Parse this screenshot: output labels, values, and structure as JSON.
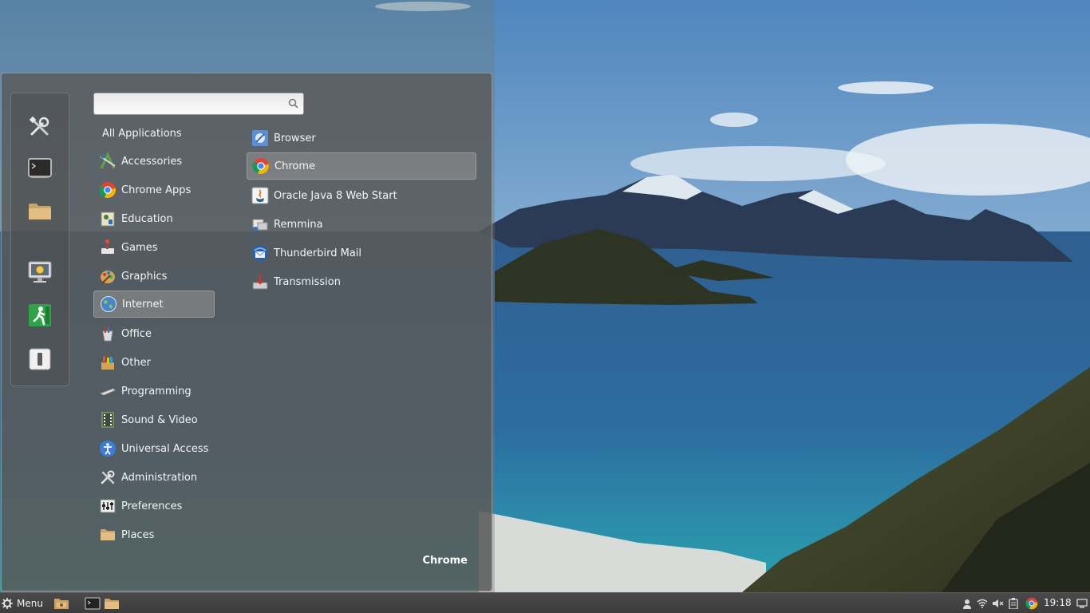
{
  "search": {
    "value": "",
    "placeholder": ""
  },
  "favorites": [
    {
      "name": "Administration tools"
    },
    {
      "name": "Terminal"
    },
    {
      "name": "Files"
    },
    {
      "name": "Lock Screen"
    },
    {
      "name": "Logout"
    },
    {
      "name": "Quit"
    }
  ],
  "categories": {
    "all": "All Applications",
    "items": [
      {
        "label": "Accessories",
        "icon": "accessories-icon"
      },
      {
        "label": "Chrome Apps",
        "icon": "chrome-icon"
      },
      {
        "label": "Education",
        "icon": "education-icon"
      },
      {
        "label": "Games",
        "icon": "games-icon"
      },
      {
        "label": "Graphics",
        "icon": "graphics-icon"
      },
      {
        "label": "Internet",
        "icon": "internet-icon"
      },
      {
        "label": "Office",
        "icon": "office-icon"
      },
      {
        "label": "Other",
        "icon": "other-icon"
      },
      {
        "label": "Programming",
        "icon": "programming-icon"
      },
      {
        "label": "Sound & Video",
        "icon": "sound-video-icon"
      },
      {
        "label": "Universal Access",
        "icon": "universal-access-icon"
      },
      {
        "label": "Administration",
        "icon": "administration-icon"
      },
      {
        "label": "Preferences",
        "icon": "preferences-icon"
      },
      {
        "label": "Places",
        "icon": "places-icon"
      }
    ],
    "selected": "Internet"
  },
  "apps": {
    "items": [
      {
        "label": "Browser",
        "icon": "browser-icon"
      },
      {
        "label": "Chrome",
        "icon": "chrome-icon"
      },
      {
        "label": "Oracle Java 8 Web Start",
        "icon": "java-icon"
      },
      {
        "label": "Remmina",
        "icon": "remmina-icon"
      },
      {
        "label": "Thunderbird Mail",
        "icon": "thunderbird-icon"
      },
      {
        "label": "Transmission",
        "icon": "transmission-icon"
      }
    ],
    "selected": "Chrome"
  },
  "selected_app_title": "Chrome",
  "panel": {
    "menu_label": "Menu",
    "clock": "19:18"
  },
  "colors": {
    "menu_bg": "#585858",
    "selection": "#969696",
    "panel_bg": "#3f3f3f"
  }
}
